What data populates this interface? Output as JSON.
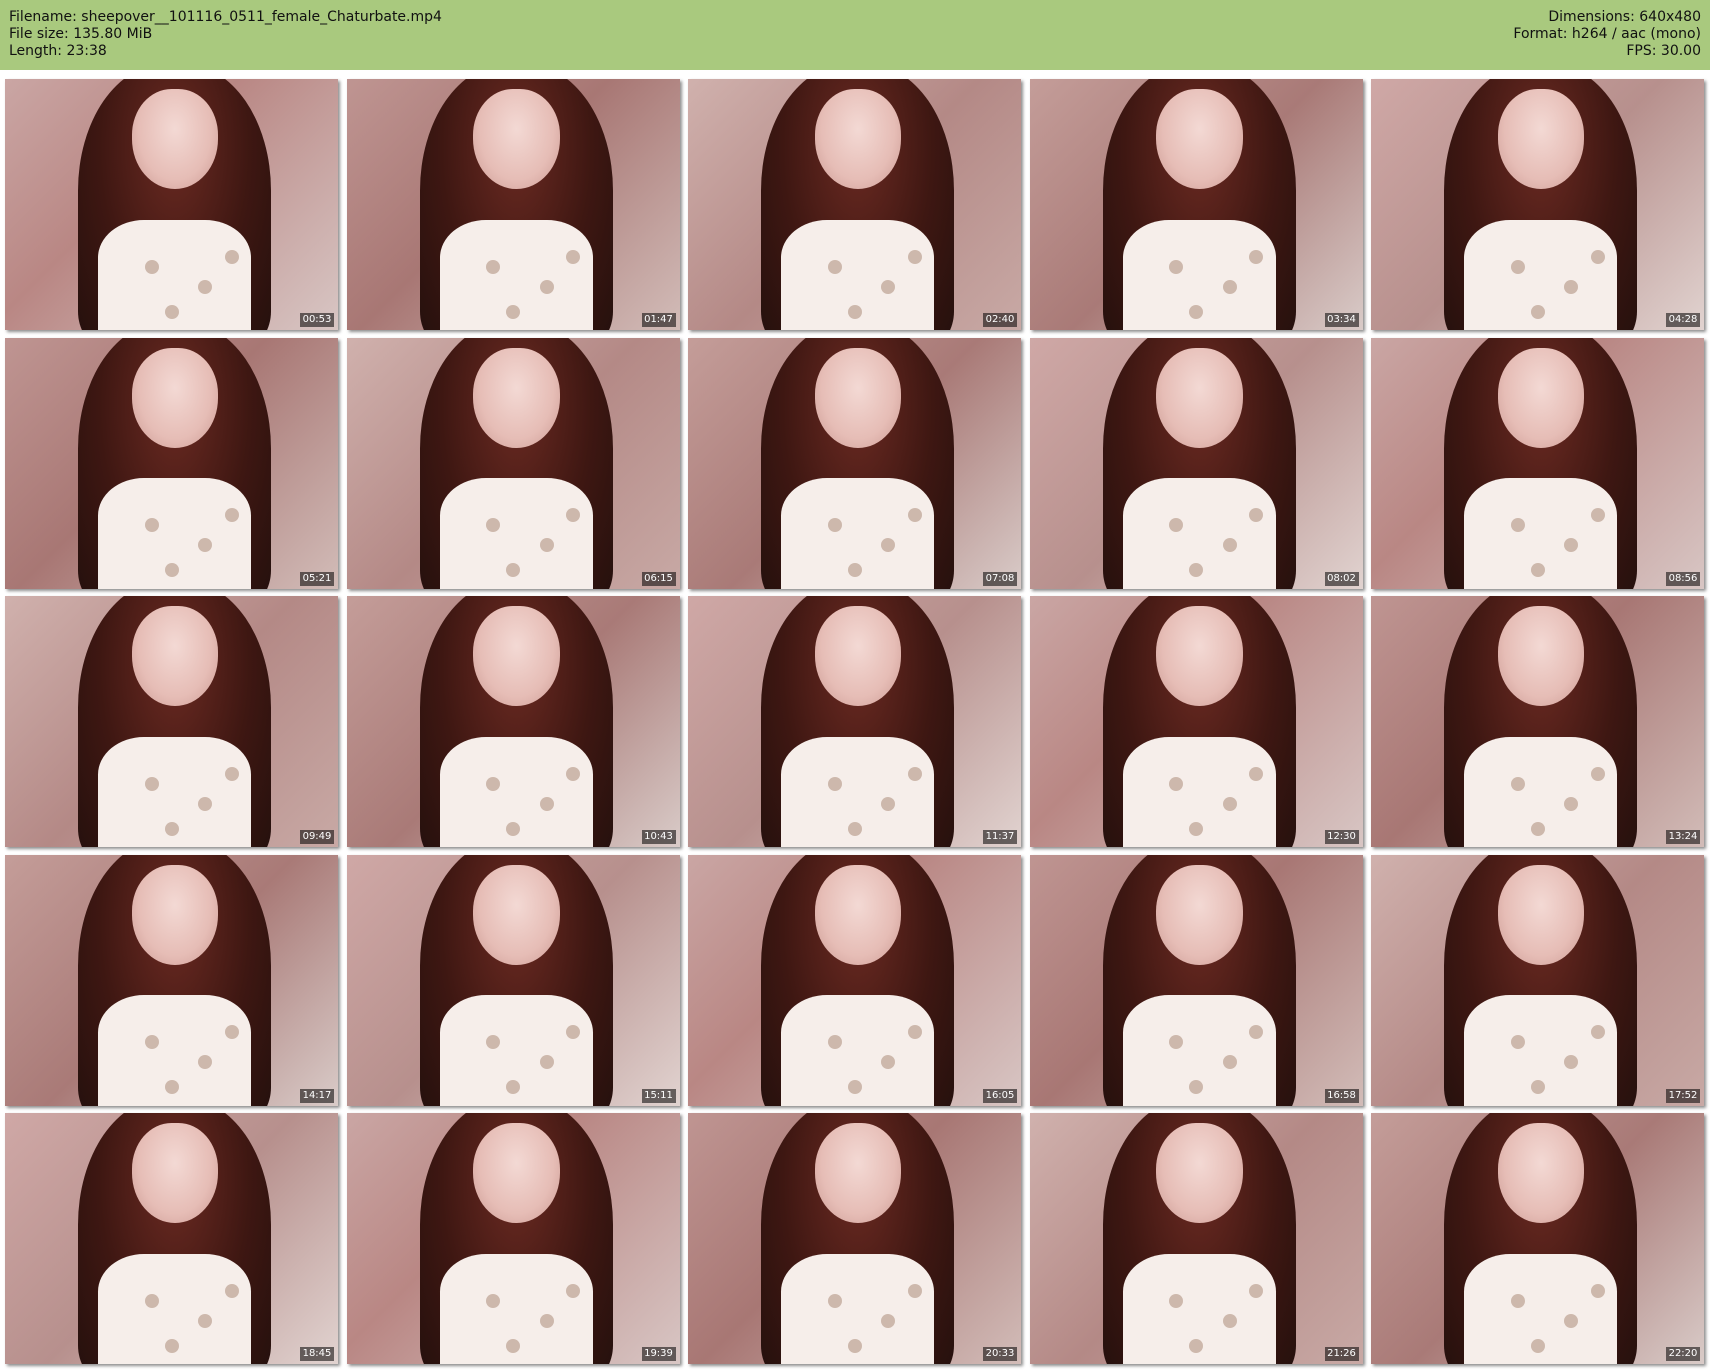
{
  "header": {
    "filename": "Filename: sheepover__101116_0511_female_Chaturbate.mp4",
    "filesize": "File size: 135.80 MiB",
    "length": "Length: 23:38",
    "dimensions": "Dimensions: 640x480",
    "format": "Format: h264 / aac (mono)",
    "fps": "FPS: 30.00"
  },
  "colors": {
    "header_bg": "#a9c97e",
    "page_bg": "#ffffff"
  },
  "thumbnails": [
    {
      "timestamp": "00:53"
    },
    {
      "timestamp": "01:47"
    },
    {
      "timestamp": "02:40"
    },
    {
      "timestamp": "03:34"
    },
    {
      "timestamp": "04:28"
    },
    {
      "timestamp": "05:21"
    },
    {
      "timestamp": "06:15"
    },
    {
      "timestamp": "07:08"
    },
    {
      "timestamp": "08:02"
    },
    {
      "timestamp": "08:56"
    },
    {
      "timestamp": "09:49"
    },
    {
      "timestamp": "10:43"
    },
    {
      "timestamp": "11:37"
    },
    {
      "timestamp": "12:30"
    },
    {
      "timestamp": "13:24"
    },
    {
      "timestamp": "14:17"
    },
    {
      "timestamp": "15:11"
    },
    {
      "timestamp": "16:05"
    },
    {
      "timestamp": "16:58"
    },
    {
      "timestamp": "17:52"
    },
    {
      "timestamp": "18:45"
    },
    {
      "timestamp": "19:39"
    },
    {
      "timestamp": "20:33"
    },
    {
      "timestamp": "21:26"
    },
    {
      "timestamp": "22:20"
    }
  ]
}
